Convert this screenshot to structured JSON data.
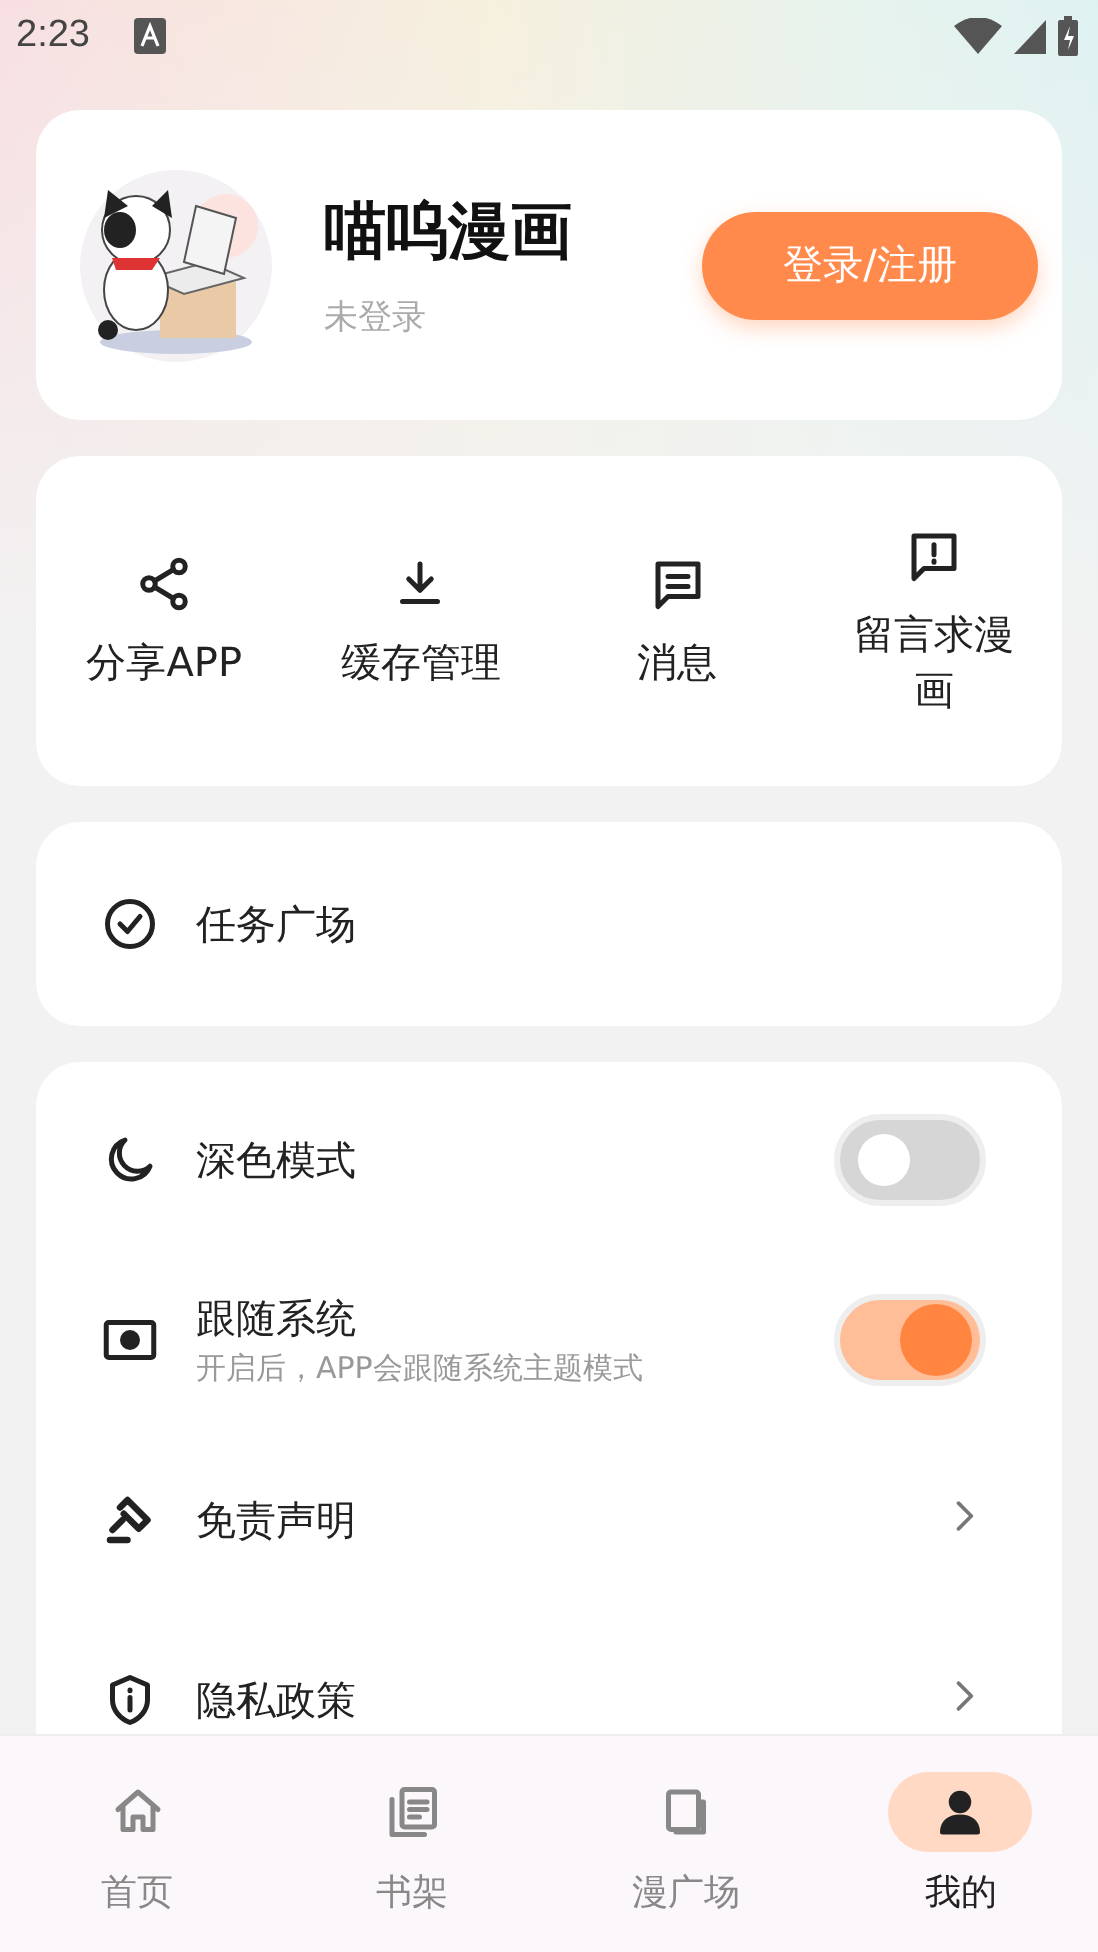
{
  "status_bar": {
    "time": "2:23"
  },
  "profile": {
    "title": "喵呜漫画",
    "subtitle": "未登录",
    "button": "登录/注册"
  },
  "shortcuts": [
    {
      "label": "分享APP"
    },
    {
      "label": "缓存管理"
    },
    {
      "label": "消息"
    },
    {
      "label": "留言求漫画"
    }
  ],
  "task": {
    "label": "任务广场"
  },
  "settings": [
    {
      "kind": "toggle",
      "label": "深色模式",
      "on": false
    },
    {
      "kind": "toggle",
      "label": "跟随系统",
      "subtitle": "开启后，APP会跟随系统主题模式",
      "on": true
    },
    {
      "kind": "link",
      "label": "免责声明"
    },
    {
      "kind": "link",
      "label": "隐私政策"
    }
  ],
  "nav": [
    {
      "label": "首页",
      "selected": false
    },
    {
      "label": "书架",
      "selected": false
    },
    {
      "label": "漫广场",
      "selected": false
    },
    {
      "label": "我的",
      "selected": true
    }
  ]
}
